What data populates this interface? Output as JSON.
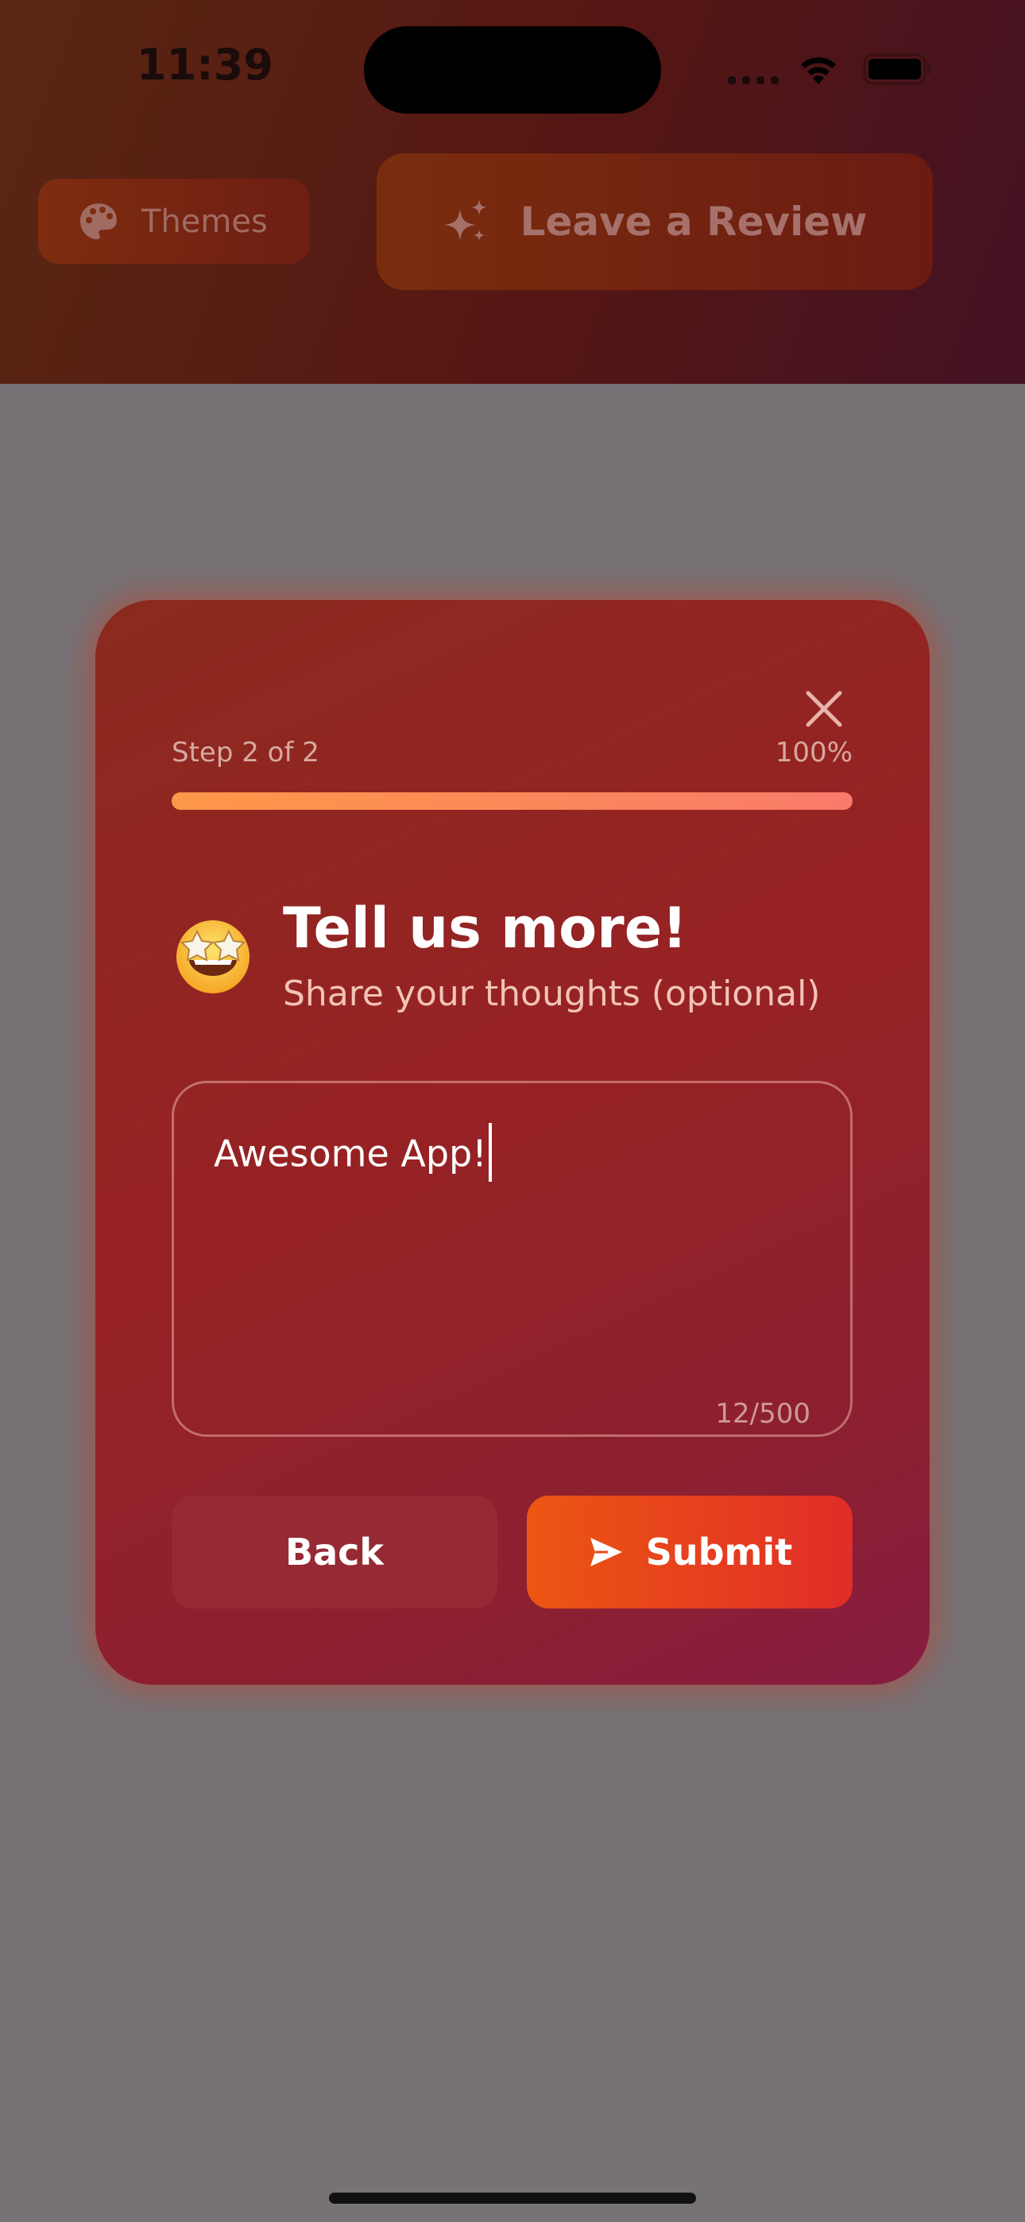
{
  "status_bar": {
    "time": "11:39"
  },
  "header": {
    "themes_label": "Themes",
    "review_label": "Leave a Review"
  },
  "modal": {
    "step_label": "Step 2 of 2",
    "progress_text": "100%",
    "progress_fraction": 1.0,
    "emoji": "star-struck",
    "title": "Tell us more!",
    "subtitle": "Share your thoughts (optional)",
    "feedback_value": "Awesome App!",
    "char_count": "12/500",
    "back_label": "Back",
    "submit_label": "Submit"
  },
  "icons": {
    "themes": "palette-icon",
    "review": "sparkles-icon",
    "close": "close-icon",
    "submit": "send-icon"
  },
  "colors": {
    "accent": "#ec5612",
    "progress_start": "#fd9848",
    "progress_end": "#f97a6a"
  }
}
